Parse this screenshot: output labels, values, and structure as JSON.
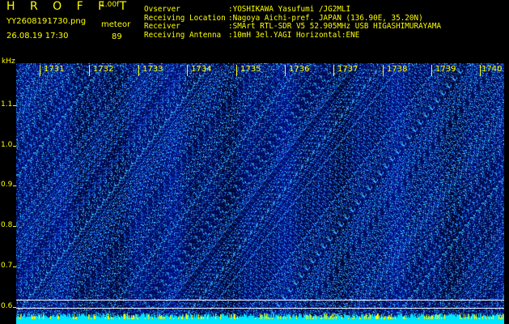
{
  "header": {
    "title": "H R O F F T",
    "version": "1.00f",
    "filename": "YY2608191730.png",
    "datetime": "26.08.19 17:30",
    "meteor_label": "meteor",
    "meteor_count": "89"
  },
  "station": {
    "keys": [
      "Ovserver",
      "Receiving Location",
      "Receiver",
      "Receiving Antenna"
    ],
    "values": [
      ":YOSHIKAWA Yasufumi /JG2MLI",
      ":Nagoya Aichi-pref. JAPAN (136.90E, 35.20N)",
      ":SMArt RTL-SDR V5 52.905MHz USB HIGASHIMURAYAMA",
      ":10mH 3el.YAGI Horizontal:ENE"
    ]
  },
  "yaxis": {
    "unit": "kHz",
    "ticks": [
      "1.1",
      "1.0",
      "0.9",
      "0.8",
      "0.7",
      "0.6"
    ]
  },
  "xaxis": {
    "ticks": [
      "1731",
      "1732",
      "1733",
      "1734",
      "1735",
      "1736",
      "1737",
      "1738",
      "1739",
      "1740"
    ]
  },
  "colors": {
    "background": "#000000",
    "label_yellow": "#ffff00",
    "spectrum_dark": "#00007a",
    "spectrum_mid": "#1e3cff",
    "spectrum_bright": "#5ff0ff"
  }
}
